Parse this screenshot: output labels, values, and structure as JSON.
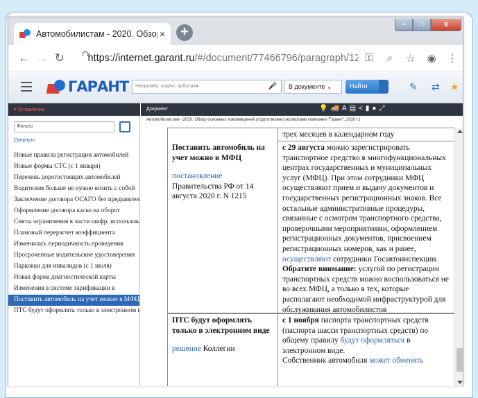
{
  "browser": {
    "tab_title": "Автомобилистам - 2020. Обзор",
    "tab_close": "×",
    "new_tab": "+",
    "window_controls": {
      "min": "–",
      "max": "□",
      "close": "x"
    },
    "url_host": "https://internet.garant.ru",
    "url_path": "/#/document/77466796/paragraph/12..."
  },
  "garant": {
    "logo_text": "ГАРАНТ",
    "search_placeholder": "Например: кодекс арбитраж",
    "scope": "В документе ⌄",
    "find_button": "Найти",
    "icons": [
      "bookmark-icon",
      "compare-icon",
      "star-icon"
    ],
    "accent_color": "#2c6ab5"
  },
  "left_panel": {
    "title": "▾ Оглавление",
    "filter_placeholder": "Фильтр",
    "collapse_label": "Свернуть",
    "items": [
      "Новые правила регистрации автомобилей",
      "Новые формы СТС (с 1 января)",
      "Перечень дорогостоящих автомобилей",
      "Водителям больше не нужно возить с собой",
      "Заключение договора ОСАГО без предъявления",
      "Оформление договора каско на оборот",
      "Сняты ограничения в части шифр, использования",
      "Плановый перерасчет коэффициента",
      "Изменилась периодичность проведения",
      "Просроченные водительские удостоверения",
      "Парковки для инвалидов (с 1 июля)",
      "Новая форма диагностической карты",
      "Изменения в системе тарификации в",
      "Поставить автомобиль на учет можно в МФЦ",
      "ПТС будут оформлять только в электронном виде"
    ],
    "active_index": 13
  },
  "document": {
    "panel_title": "Документ",
    "breadcrumb": "Автомобилистам - 2020. Обзор основных нововведений (подготовлено экспертами компании \"Гарант\", 2020 г.)",
    "row0_right": "трех месяцев в календарном году",
    "row1": {
      "title": "Поставить автомобиль на учет можно в МФЦ",
      "link": "постановление",
      "source": "Правительства РФ от 14 августа 2020 г. N 1215",
      "date_bold": "с 29 августа",
      "text_a": "можно зарегистрировать транспортное средство в многофункциональных центрах государственных и муниципальных услуг (МФЦ). При этом сотрудники МФЦ осуществляют прием и выдачу документов и государственных регистрационных знаков. Все остальные административные процедуры, связанные с осмотром транспортного средства, проверочными мероприятиями, оформлением регистрационных документов, присвоением регистрационных номеров, как и ранее,",
      "link2": "осуществляют",
      "text_b": "сотрудники Госавтоинспекции.",
      "note_bold": "Обратите внимание:",
      "note_text": "услугой по регистрации транспортных средств можно воспользоваться не во всех МФЦ, а только в тех, которые располагают необходимой инфраструктурой для обслуживания автомобилистов"
    },
    "row2": {
      "title": "ПТС будут оформлять только в электронном виде",
      "link": "решение",
      "source": "Коллегии",
      "date_bold": "с 1 ноября",
      "text_a": "паспорта транспортных средств (паспорта шасси транспортных средств) по общему правилу",
      "link2": "будут оформляться",
      "text_b": "в электронном виде.",
      "text_c": "Собственник автомобиля",
      "link3": "может обменять"
    }
  }
}
